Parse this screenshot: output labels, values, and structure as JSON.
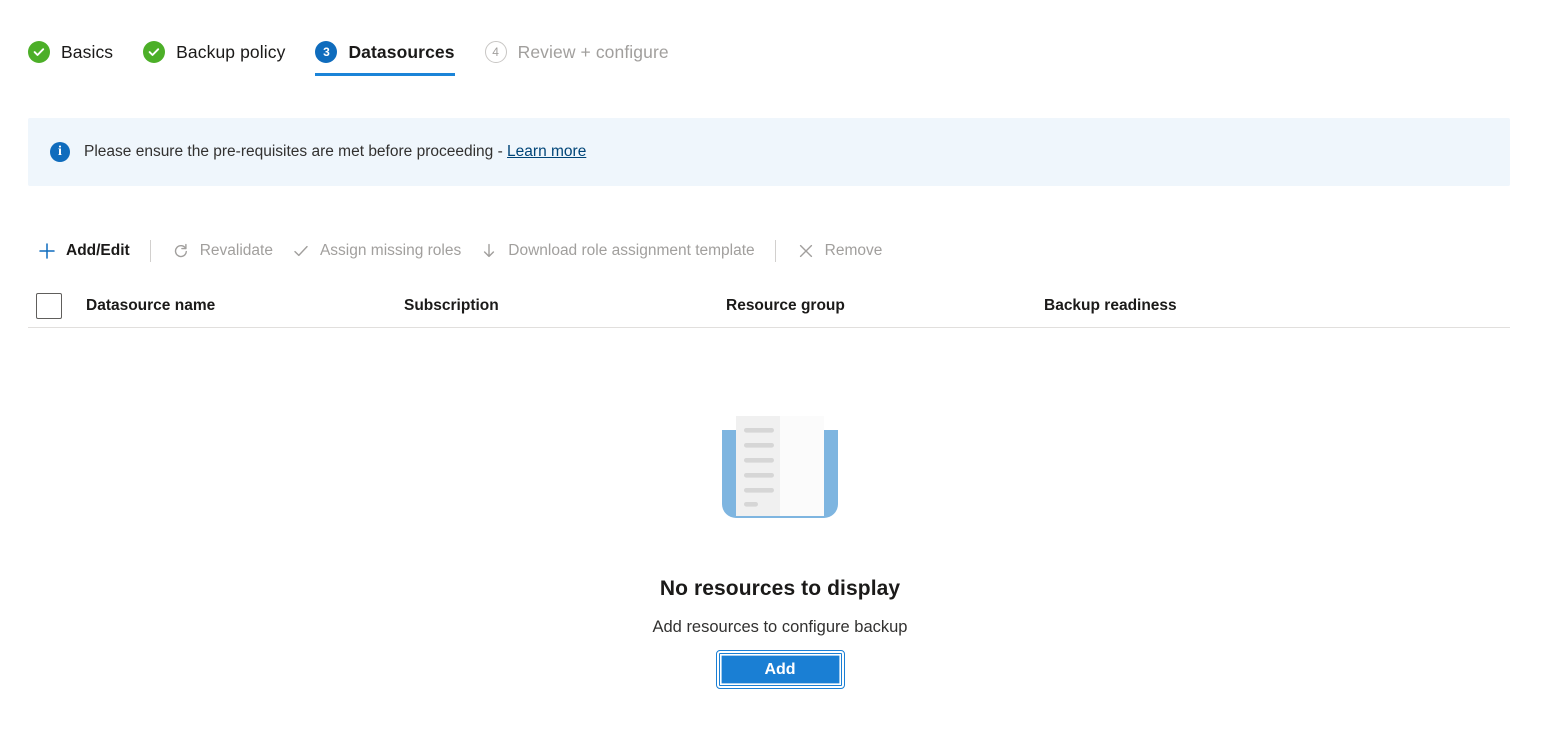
{
  "wizard": {
    "tabs": [
      {
        "label": "Basics",
        "state": "done",
        "marker": "check-icon"
      },
      {
        "label": "Backup policy",
        "state": "done",
        "marker": "check-icon"
      },
      {
        "label": "Datasources",
        "state": "current",
        "marker": "3"
      },
      {
        "label": "Review + configure",
        "state": "upcoming",
        "marker": "4"
      }
    ]
  },
  "banner": {
    "icon": "info-icon",
    "text": "Please ensure the pre-requisites are met before proceeding - ",
    "link_label": "Learn more"
  },
  "toolbar": {
    "commands": [
      {
        "label": "Add/Edit",
        "icon": "plus-icon",
        "enabled": true
      },
      {
        "label": "Revalidate",
        "icon": "refresh-icon",
        "enabled": false
      },
      {
        "label": "Assign missing roles",
        "icon": "check-icon",
        "enabled": false
      },
      {
        "label": "Download role assignment template",
        "icon": "download-icon",
        "enabled": false
      },
      {
        "label": "Remove",
        "icon": "close-icon",
        "enabled": false
      }
    ]
  },
  "table": {
    "select_all_checked": false,
    "columns": [
      "Datasource name",
      "Subscription",
      "Resource group",
      "Backup readiness"
    ],
    "rows": []
  },
  "empty_state": {
    "illustration": "open-book-illustration",
    "title": "No resources to display",
    "subtitle": "Add resources to configure backup",
    "button_label": "Add"
  },
  "colors": {
    "accent_blue": "#0f6cbd",
    "button_blue": "#1a7fd4",
    "tab_underline": "#1b84d8",
    "success_green": "#4caf28",
    "banner_bg": "#eff6fc",
    "disabled_text": "#a19f9d",
    "link": "#004578"
  }
}
